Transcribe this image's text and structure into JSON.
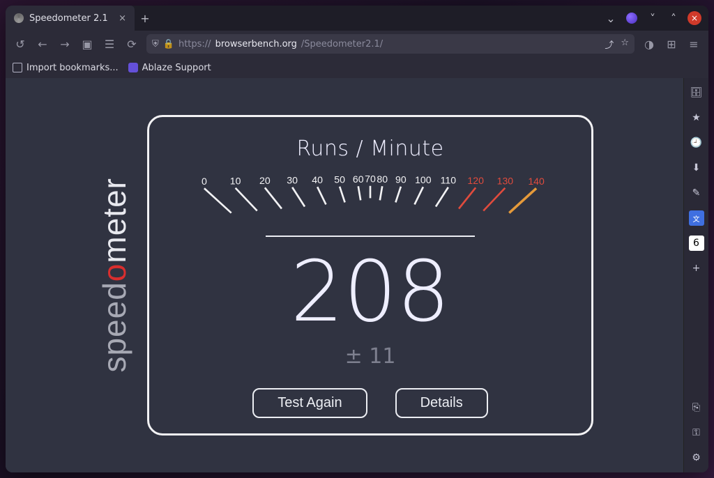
{
  "tab": {
    "title": "Speedometer 2.1"
  },
  "url": {
    "proto": "https://",
    "host": "browserbench.org",
    "path": "/Speedometer2.1/"
  },
  "bookmarks": {
    "import": "Import bookmarks...",
    "a": "Ablaze Support"
  },
  "logo": {
    "p1": "speed",
    "p2": "o",
    "p3": "meter"
  },
  "result": {
    "title": "Runs / Minute",
    "score": "208",
    "margin": "± 11",
    "btn_again": "Test Again",
    "btn_details": "Details"
  },
  "gauge": {
    "labels": [
      "0",
      "10",
      "20",
      "30",
      "40",
      "50",
      "60",
      "70",
      "80",
      "90",
      "100",
      "110",
      "120",
      "130",
      "140"
    ]
  }
}
